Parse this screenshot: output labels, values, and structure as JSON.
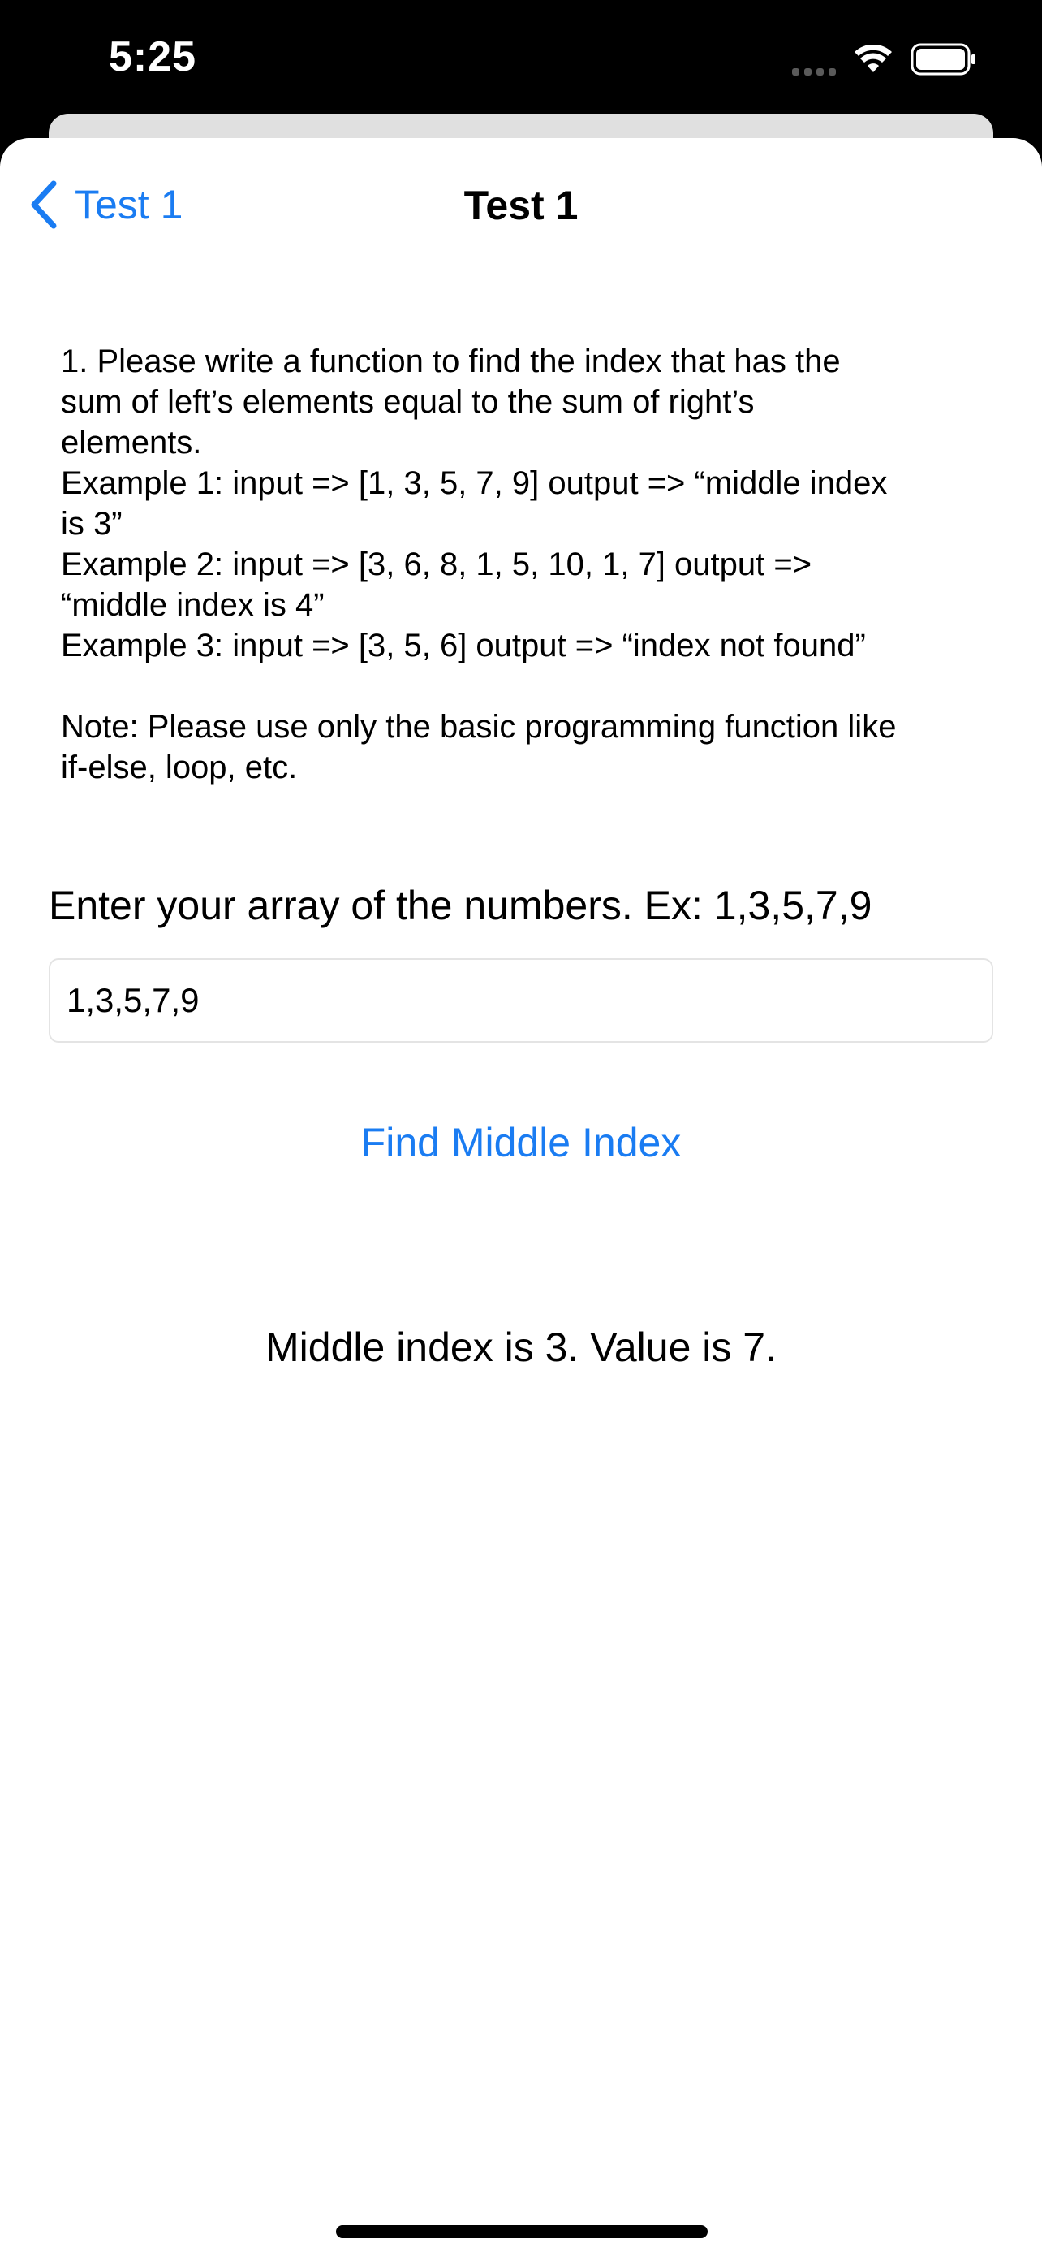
{
  "status_bar": {
    "time": "5:25",
    "icons": [
      "cellular-signal-icon",
      "wifi-icon",
      "battery-icon"
    ]
  },
  "nav": {
    "back_label": "Test 1",
    "title": "Test 1"
  },
  "question": {
    "text": "1. Please write a function to find the index that has the\nsum of left’s elements equal to the sum of right’s\nelements.\nExample 1: input => [1, 3, 5, 7, 9] output => “middle index\nis 3”\nExample 2: input => [3, 6, 8, 1, 5, 10, 1, 7] output =>\n“middle index is 4”\nExample 3: input => [3, 5, 6] output => “index not found”\n\nNote: Please use only the basic programming function like\nif-else, loop, etc."
  },
  "form": {
    "prompt": "Enter your array of the numbers. Ex: 1,3,5,7,9",
    "input_value": "1,3,5,7,9",
    "button_label": "Find Middle Index"
  },
  "result": {
    "text": "Middle index is 3. Value is 7."
  },
  "colors": {
    "accent": "#1a7cf2",
    "background": "#ffffff",
    "status_bar": "#000000"
  }
}
